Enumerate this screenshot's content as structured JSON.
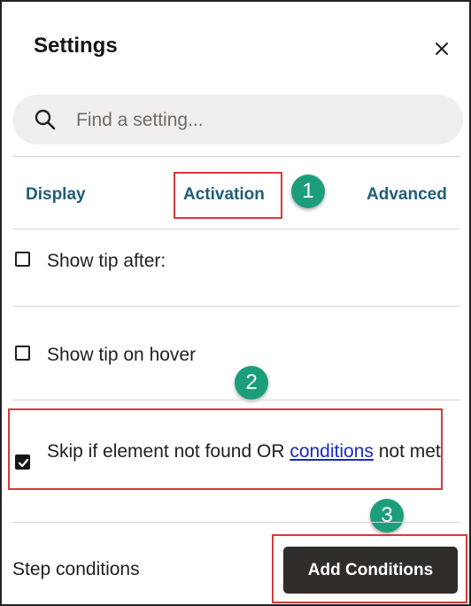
{
  "panel": {
    "title": "Settings",
    "close_icon": "close-icon"
  },
  "search": {
    "placeholder": "Find a setting...",
    "icon": "search-icon"
  },
  "tabs": [
    {
      "label": "Display",
      "active": false
    },
    {
      "label": "Activation",
      "active": true
    },
    {
      "label": "Advanced",
      "active": false
    }
  ],
  "options": [
    {
      "label": "Show tip after:",
      "checked": false
    },
    {
      "label": "Show tip on hover",
      "checked": false
    }
  ],
  "skip": {
    "checked": true,
    "text_before": "Skip if element not found OR ",
    "link_text": "conditions",
    "text_after": " not met"
  },
  "step": {
    "label": "Step conditions",
    "button_label": "Add Conditions"
  },
  "callouts": [
    "1",
    "2",
    "3"
  ],
  "colors": {
    "accent_tab": "#1f5e7a",
    "callout_border": "#d53a3a",
    "badge": "#1d9e7b",
    "button": "#312d2a",
    "link": "#1a28c9"
  }
}
